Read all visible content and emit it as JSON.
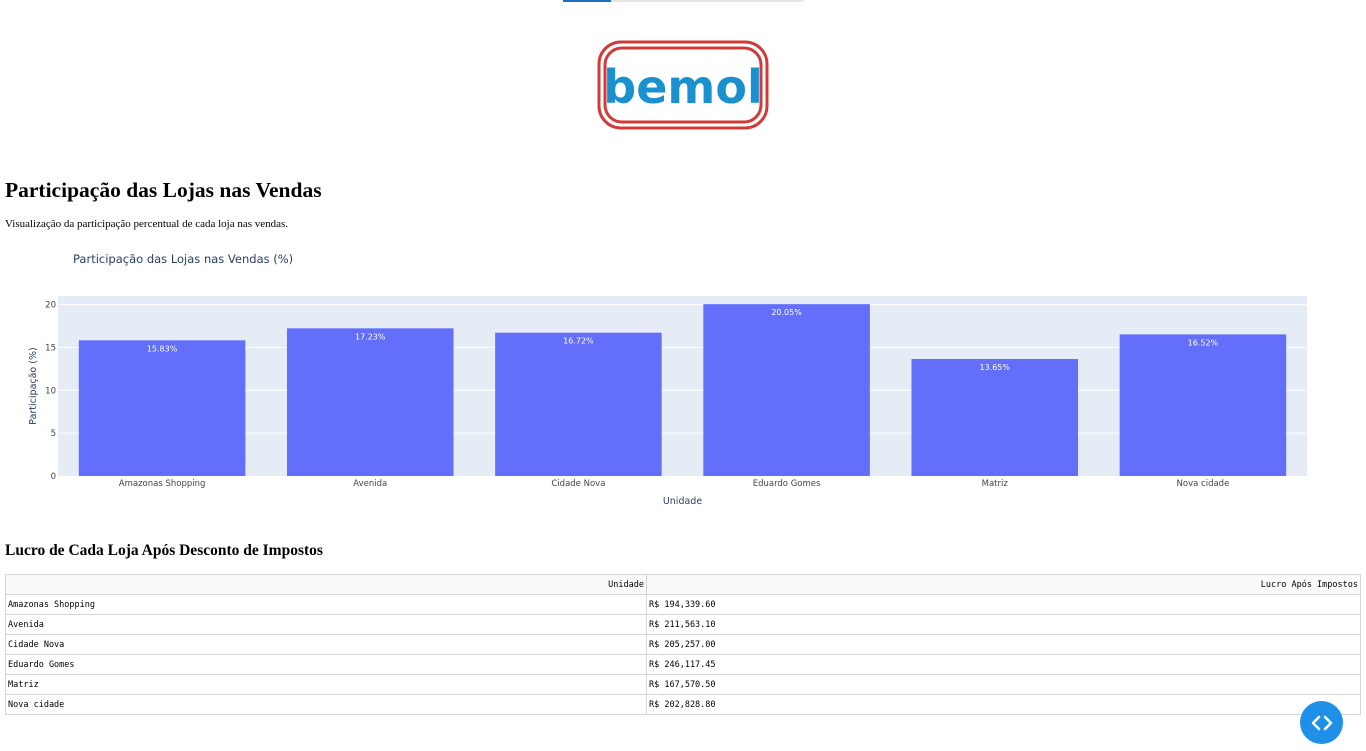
{
  "logo": {
    "text": "bemol",
    "brand_red": "#d23a3a",
    "brand_blue": "#1b90cf"
  },
  "heading": "Participação das Lojas nas Vendas",
  "description": "Visualização da participação percentual de cada loja nas vendas.",
  "chart_data": {
    "type": "bar",
    "title": "Participação das Lojas nas Vendas (%)",
    "xlabel": "Unidade",
    "ylabel": "Participação (%)",
    "categories": [
      "Amazonas Shopping",
      "Avenida",
      "Cidade Nova",
      "Eduardo Gomes",
      "Matriz",
      "Nova cidade"
    ],
    "values": [
      15.83,
      17.23,
      16.72,
      20.05,
      13.65,
      16.52
    ],
    "value_labels": [
      "15.83%",
      "17.23%",
      "16.72%",
      "20.05%",
      "13.65%",
      "16.52%"
    ],
    "ylim": [
      0,
      21
    ],
    "yticks": [
      0,
      5,
      10,
      15,
      20
    ],
    "grid": true,
    "bar_color": "#636efa",
    "plot_bg": "#e5ecf6"
  },
  "profit_table": {
    "heading": "Lucro de Cada Loja Após Desconto de Impostos",
    "columns": [
      "Unidade",
      "Lucro Após Impostos"
    ],
    "rows": [
      [
        "Amazonas Shopping",
        "R$ 194,339.60"
      ],
      [
        "Avenida",
        "R$ 211,563.10"
      ],
      [
        "Cidade Nova",
        "R$ 205,257.00"
      ],
      [
        "Eduardo Gomes",
        "R$ 246,117.45"
      ],
      [
        "Matriz",
        "R$ 167,570.50"
      ],
      [
        "Nova cidade",
        "R$ 202,828.80"
      ]
    ]
  },
  "code_button": {
    "icon": "code-icon",
    "color": "#1e90e8"
  }
}
